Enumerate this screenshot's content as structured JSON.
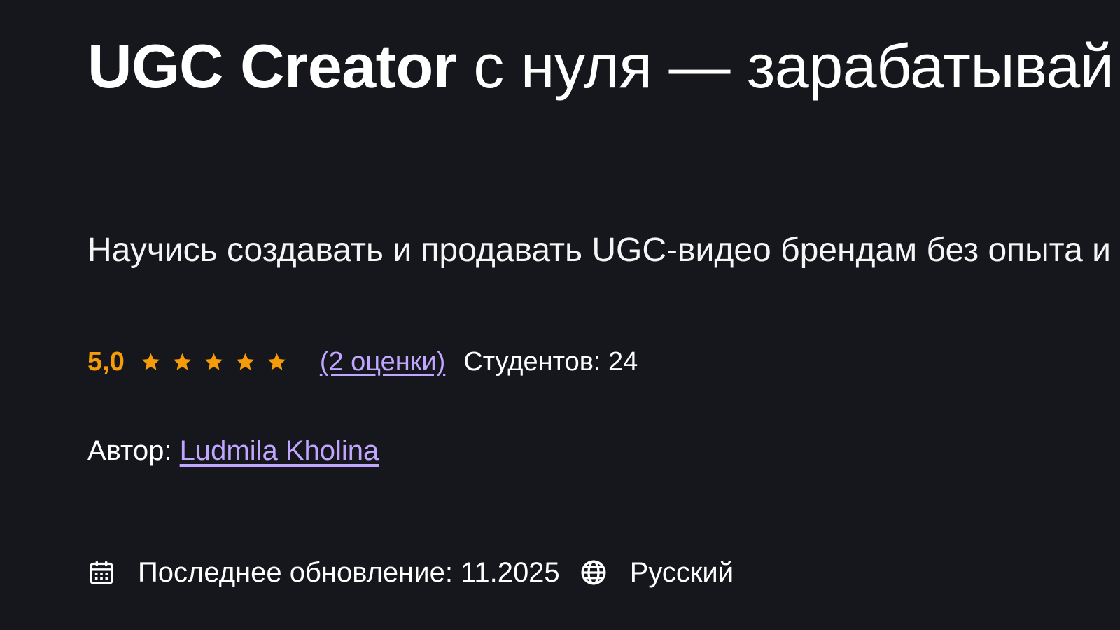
{
  "course": {
    "title_bold": "UGC Creator",
    "title_rest": " с нуля — зарабатывай на видео для брендов",
    "subtitle": "Научись создавать и продавать UGC-видео брендам без опыта и вложений"
  },
  "rating": {
    "value": "5,0",
    "stars": 5,
    "star_color": "#f69c08",
    "ratings_link": "(2 оценки)",
    "students": "Студентов: 24"
  },
  "author": {
    "label": "Автор: ",
    "name": "Ludmila Kholina"
  },
  "meta": {
    "calendar_icon": "calendar-icon",
    "last_update": "Последнее обновление: 11.2025",
    "globe_icon": "globe-icon",
    "language": "Русский"
  },
  "colors": {
    "background": "#16171c",
    "link": "#c0a6ff",
    "rating": "#f69c08"
  }
}
